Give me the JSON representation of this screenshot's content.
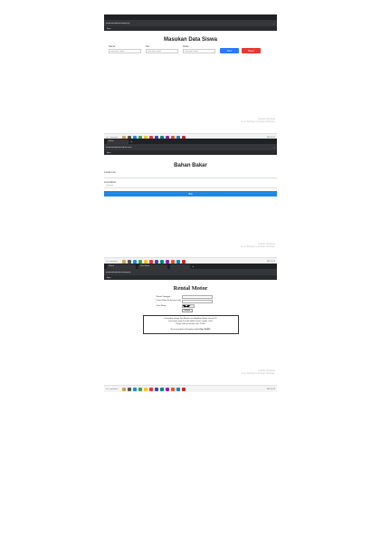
{
  "screens": [
    {
      "browser": {
        "tabs": [],
        "url": "localhost/latihan/hasil.php",
        "bookmark": "Apps"
      },
      "form": {
        "title": "Masukan Data Siswa",
        "fields": [
          {
            "label": "Nama :",
            "placeholder": "Masukan nama"
          },
          {
            "label": "Nis :",
            "placeholder": "Masukan nama"
          },
          {
            "label": "Kelas :",
            "placeholder": "Masukan nama"
          }
        ],
        "submit_label": "Kirim",
        "reset_label": "Reset"
      },
      "watermark": [
        "Activate Windows",
        "Go to Settings to activate Windows."
      ],
      "taskbar": {
        "weather": "26°C Berawan",
        "tray": "IND 10:21"
      }
    },
    {
      "browser": {
        "tabs": [
          "Bahan"
        ],
        "url": "localhost/latihan/bahan.html",
        "bookmark": "Apps"
      },
      "form": {
        "title": "Bahan Bakar",
        "fields": [
          {
            "label": "Jumlah Liter",
            "placeholder": ""
          },
          {
            "label": "Jenis Bahan",
            "placeholder": "Pertalite"
          }
        ],
        "submit_label": "Beli"
      },
      "watermark": [
        "Activate Windows",
        "Go to Settings to activate Windows."
      ],
      "taskbar": {
        "weather": "26°C Berawan",
        "tray": "IND 10:22"
      }
    },
    {
      "browser": {
        "tabs": [
          "Rental",
          "Data Siswa",
          ""
        ],
        "url": "localhost/latihan/rental.php",
        "bookmark": "Apps"
      },
      "form": {
        "title": "Rental Motor",
        "fields": [
          {
            "label": "Nama Pelanggan :",
            "value": ""
          },
          {
            "label": "Lama Waktu Rental (per hari) :",
            "value": ""
          },
          {
            "label": "Jenis Motor:",
            "value": "Scooter"
          }
        ],
        "submit_label": "Submit"
      },
      "result": {
        "line1": "is berstatus sebagai Non Member mendapatkan diskon sebesar 0%",
        "line2": "Jenis motor yang di rental adalah Scooter selama 1 hari",
        "line3": "Harga rental per harinya: Rp. 70.000",
        "total_prefix": "Besar yang harus di bayarkan adalah",
        "total_value": "Rp. 100.000"
      },
      "watermark": [
        "Activate Windows",
        "Go to Settings to activate Windows."
      ],
      "taskbar": {
        "weather": "26°C Berawan",
        "tray": "IND 10:23"
      }
    }
  ]
}
